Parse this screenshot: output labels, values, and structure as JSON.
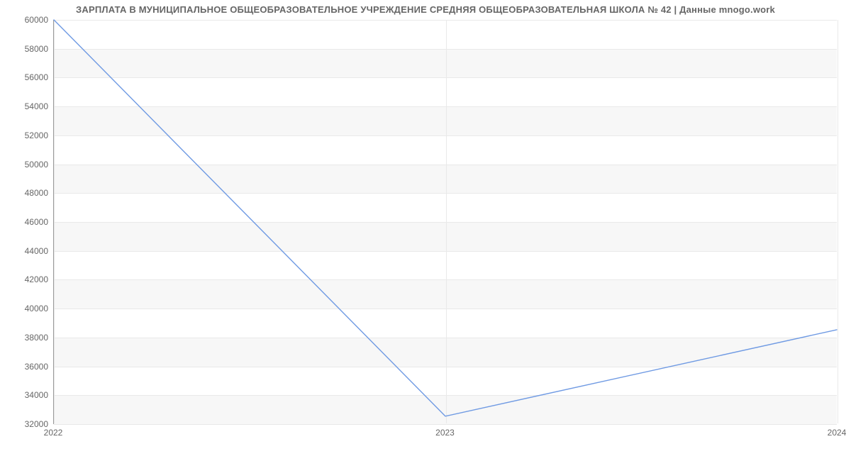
{
  "chart_data": {
    "type": "line",
    "title": "ЗАРПЛАТА В МУНИЦИПАЛЬНОЕ ОБЩЕОБРАЗОВАТЕЛЬНОЕ УЧРЕЖДЕНИЕ СРЕДНЯЯ ОБЩЕОБРАЗОВАТЕЛЬНАЯ ШКОЛА № 42 | Данные mnogo.work",
    "xlabel": "",
    "ylabel": "",
    "x": [
      2022,
      2023,
      2024
    ],
    "values": [
      60000,
      32500,
      38500
    ],
    "x_ticks": [
      2022,
      2023,
      2024
    ],
    "y_ticks": [
      32000,
      34000,
      36000,
      38000,
      40000,
      42000,
      44000,
      46000,
      48000,
      50000,
      52000,
      54000,
      56000,
      58000,
      60000
    ],
    "xlim": [
      2022,
      2024
    ],
    "ylim": [
      32000,
      60000
    ],
    "line_color": "#6f9ae3",
    "band_color": "#f7f7f7"
  }
}
